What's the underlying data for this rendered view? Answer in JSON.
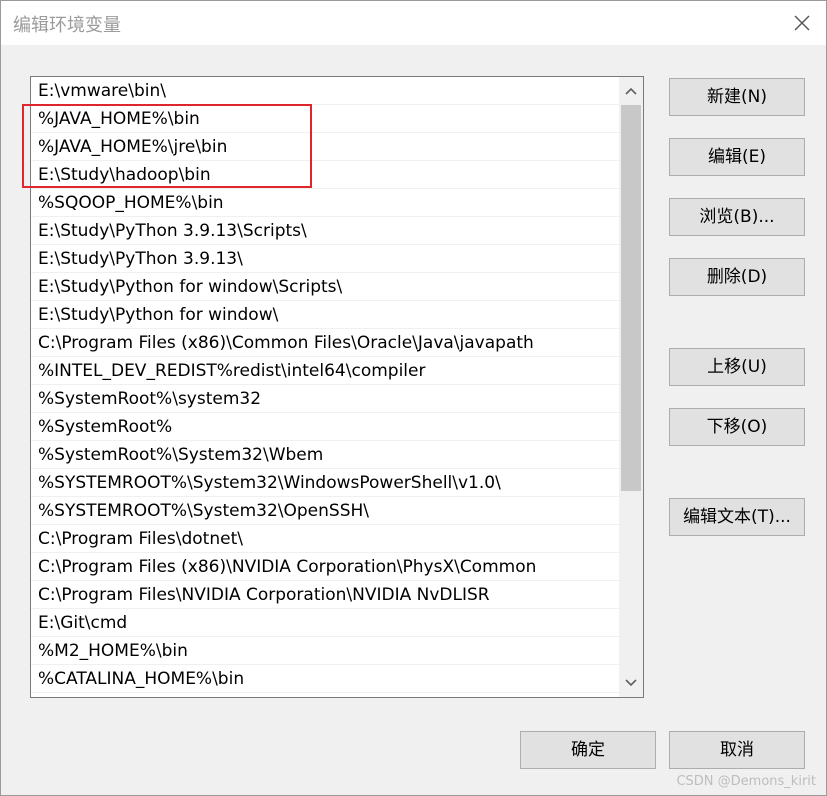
{
  "window": {
    "title": "编辑环境变量",
    "close_icon": "close-icon"
  },
  "list": {
    "items": [
      "E:\\vmware\\bin\\",
      "%JAVA_HOME%\\bin",
      "%JAVA_HOME%\\jre\\bin",
      "E:\\Study\\hadoop\\bin",
      "%SQOOP_HOME%\\bin",
      "E:\\Study\\PyThon 3.9.13\\Scripts\\",
      "E:\\Study\\PyThon 3.9.13\\",
      "E:\\Study\\Python for window\\Scripts\\",
      "E:\\Study\\Python for window\\",
      "C:\\Program Files (x86)\\Common Files\\Oracle\\Java\\javapath",
      "%INTEL_DEV_REDIST%redist\\intel64\\compiler",
      "%SystemRoot%\\system32",
      "%SystemRoot%",
      "%SystemRoot%\\System32\\Wbem",
      "%SYSTEMROOT%\\System32\\WindowsPowerShell\\v1.0\\",
      "%SYSTEMROOT%\\System32\\OpenSSH\\",
      "C:\\Program Files\\dotnet\\",
      "C:\\Program Files (x86)\\NVIDIA Corporation\\PhysX\\Common",
      "C:\\Program Files\\NVIDIA Corporation\\NVIDIA NvDLISR",
      "E:\\Git\\cmd",
      "%M2_HOME%\\bin",
      "%CATALINA_HOME%\\bin"
    ],
    "scroll_up_icon": "chevron-up-icon",
    "scroll_down_icon": "chevron-down-icon"
  },
  "buttons": {
    "new": "新建(N)",
    "edit": "编辑(E)",
    "browse": "浏览(B)...",
    "delete": "删除(D)",
    "move_up": "上移(U)",
    "move_down": "下移(O)",
    "edit_text": "编辑文本(T)...",
    "ok": "确定",
    "cancel": "取消"
  },
  "annotation": {
    "highlight_color": "#e0262b"
  },
  "watermark": "CSDN @Demons_kirit"
}
